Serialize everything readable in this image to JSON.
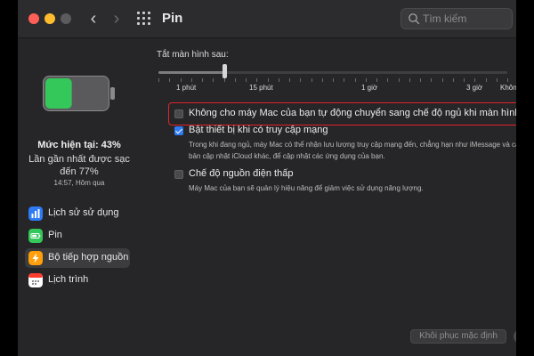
{
  "window": {
    "title": "Pin"
  },
  "search": {
    "placeholder": "Tìm kiếm"
  },
  "battery": {
    "level_text": "Mức hiện tại: 43%",
    "level": 0.43,
    "last_charge_text": "Lần gần nhất được sạc đến 77%",
    "last_charge_time": "14:57, Hôm qua"
  },
  "sidebar": {
    "items": [
      {
        "label": "Lịch sử sử dụng",
        "icon": "bar-chart-icon",
        "color": "#2f7bf5",
        "active": false
      },
      {
        "label": "Pin",
        "icon": "battery-icon",
        "color": "#34c759",
        "active": false
      },
      {
        "label": "Bộ tiếp hợp nguồn",
        "icon": "bolt-icon",
        "color": "#ff9f0a",
        "active": true
      },
      {
        "label": "Lịch trình",
        "icon": "calendar-icon",
        "color": "#ffffff",
        "active": false
      }
    ]
  },
  "display_sleep": {
    "label": "Tắt màn hình sau:",
    "ticks": [
      "1 phút",
      "15 phút",
      "1 giờ",
      "3 giờ",
      "Không"
    ],
    "value_fraction": 0.19
  },
  "options": [
    {
      "label": "Không cho máy Mac của bạn tự động chuyển sang chế độ ngủ khi màn hình tắt",
      "checked": false,
      "description": ""
    },
    {
      "label": "Bật thiết bị khi có truy cập mạng",
      "checked": true,
      "description": "Trong khi đang ngủ, máy Mac có thể nhận lưu lượng truy cập mạng đến, chẳng hạn như iMessage và các bản cập nhật iCloud khác, để cập nhật các ứng dụng của bạn."
    },
    {
      "label": "Chế độ nguồn điện thấp",
      "checked": false,
      "description": "Máy Mac của bạn sẽ quản lý hiệu năng để giảm việc sử dụng năng lượng."
    }
  ],
  "footer": {
    "restore_label": "Khôi phục mặc định",
    "help_label": "?"
  },
  "colors": {
    "accent": "#2f7bf5",
    "highlight": "#e0222a",
    "battery_fill": "#34c759"
  }
}
